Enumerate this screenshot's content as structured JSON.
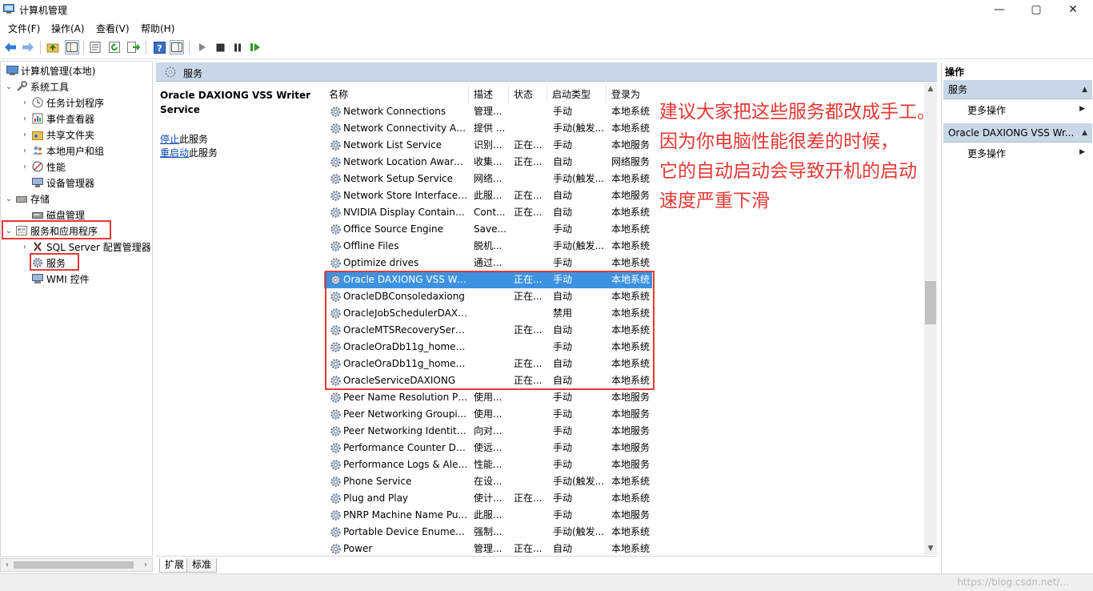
{
  "window": {
    "title": "计算机管理",
    "controls": {
      "minimize": "—",
      "maximize": "▢",
      "close": "✕"
    }
  },
  "menu": [
    "文件(F)",
    "操作(A)",
    "查看(V)",
    "帮助(H)"
  ],
  "tree": {
    "root": "计算机管理(本地)",
    "system_tools": "系统工具",
    "task_scheduler": "任务计划程序",
    "event_viewer": "事件查看器",
    "shared_folders": "共享文件夹",
    "local_users": "本地用户和组",
    "performance": "性能",
    "device_manager": "设备管理器",
    "storage": "存储",
    "disk_management": "磁盘管理",
    "services_apps": "服务和应用程序",
    "sql_server": "SQL Server 配置管理器",
    "services": "服务",
    "wmi": "WMI 控件"
  },
  "center": {
    "header": "服务",
    "selected_service_title": "Oracle DAXIONG VSS Writer Service",
    "stop_link": "停止",
    "stop_suffix": "此服务",
    "restart_link": "重启动",
    "restart_suffix": "此服务"
  },
  "table": {
    "columns": [
      "名称",
      "描述",
      "状态",
      "启动类型",
      "登录为"
    ],
    "rows": [
      {
        "name": "Network Connections",
        "desc": "管理...",
        "status": "",
        "startup": "手动",
        "logon": "本地系统"
      },
      {
        "name": "Network Connectivity Ass...",
        "desc": "提供 ...",
        "status": "",
        "startup": "手动(触发...",
        "logon": "本地系统"
      },
      {
        "name": "Network List Service",
        "desc": "识别...",
        "status": "正在...",
        "startup": "手动",
        "logon": "本地服务"
      },
      {
        "name": "Network Location Aware...",
        "desc": "收集...",
        "status": "正在...",
        "startup": "自动",
        "logon": "网络服务"
      },
      {
        "name": "Network Setup Service",
        "desc": "网络...",
        "status": "",
        "startup": "手动(触发...",
        "logon": "本地系统"
      },
      {
        "name": "Network Store Interface ...",
        "desc": "此服...",
        "status": "正在...",
        "startup": "自动",
        "logon": "本地服务"
      },
      {
        "name": "NVIDIA Display Containe...",
        "desc": "Cont...",
        "status": "正在...",
        "startup": "自动",
        "logon": "本地系统"
      },
      {
        "name": "Office  Source Engine",
        "desc": "Save...",
        "status": "",
        "startup": "手动",
        "logon": "本地系统"
      },
      {
        "name": "Offline Files",
        "desc": "脱机...",
        "status": "",
        "startup": "手动(触发...",
        "logon": "本地系统"
      },
      {
        "name": "Optimize drives",
        "desc": "通过...",
        "status": "",
        "startup": "手动",
        "logon": "本地系统"
      },
      {
        "name": "Oracle DAXIONG VSS Wr...",
        "desc": "",
        "status": "正在...",
        "startup": "手动",
        "logon": "本地系统"
      },
      {
        "name": "OracleDBConsoledaxiong",
        "desc": "",
        "status": "正在...",
        "startup": "自动",
        "logon": "本地系统"
      },
      {
        "name": "OracleJobSchedulerDAXI...",
        "desc": "",
        "status": "",
        "startup": "禁用",
        "logon": "本地系统"
      },
      {
        "name": "OracleMTSRecoveryServi...",
        "desc": "",
        "status": "正在...",
        "startup": "自动",
        "logon": "本地系统"
      },
      {
        "name": "OracleOraDb11g_home1...",
        "desc": "",
        "status": "",
        "startup": "手动",
        "logon": "本地系统"
      },
      {
        "name": "OracleOraDb11g_home1...",
        "desc": "",
        "status": "正在...",
        "startup": "自动",
        "logon": "本地系统"
      },
      {
        "name": "OracleServiceDAXIONG",
        "desc": "",
        "status": "正在...",
        "startup": "自动",
        "logon": "本地系统"
      },
      {
        "name": "Peer Name Resolution Pr...",
        "desc": "使用...",
        "status": "",
        "startup": "手动",
        "logon": "本地服务"
      },
      {
        "name": "Peer Networking Groupi...",
        "desc": "使用...",
        "status": "",
        "startup": "手动",
        "logon": "本地服务"
      },
      {
        "name": "Peer Networking Identity...",
        "desc": "向对...",
        "status": "",
        "startup": "手动",
        "logon": "本地服务"
      },
      {
        "name": "Performance Counter DL...",
        "desc": "使远...",
        "status": "",
        "startup": "手动",
        "logon": "本地服务"
      },
      {
        "name": "Performance Logs & Aler...",
        "desc": "性能...",
        "status": "",
        "startup": "手动",
        "logon": "本地服务"
      },
      {
        "name": "Phone Service",
        "desc": "在设...",
        "status": "",
        "startup": "手动(触发...",
        "logon": "本地系统"
      },
      {
        "name": "Plug and Play",
        "desc": "使计...",
        "status": "正在...",
        "startup": "手动",
        "logon": "本地系统"
      },
      {
        "name": "PNRP Machine Name Pu...",
        "desc": "此服...",
        "status": "",
        "startup": "手动",
        "logon": "本地服务"
      },
      {
        "name": "Portable Device Enumera...",
        "desc": "强制...",
        "status": "",
        "startup": "手动(触发...",
        "logon": "本地系统"
      },
      {
        "name": "Power",
        "desc": "管理...",
        "status": "正在...",
        "startup": "自动",
        "logon": "本地系统"
      }
    ]
  },
  "tabs": [
    "扩展",
    "标准"
  ],
  "actions": {
    "title": "操作",
    "section1": "服务",
    "more1": "更多操作",
    "section2": "Oracle DAXIONG VSS Wr...",
    "more2": "更多操作"
  },
  "annotation": {
    "line1": "建议大家把这些服务都改成手工。",
    "line2": "因为你电脑性能很差的时候，",
    "line3": "它的自动启动会导致开机的启动",
    "line4": "速度严重下滑"
  },
  "colors": {
    "selection": "#3c92e0",
    "header_blue": "#c9d7e8",
    "annotation_red": "#e53935",
    "link": "#0645ad"
  },
  "watermark": "https://blog.csdn.net/..."
}
